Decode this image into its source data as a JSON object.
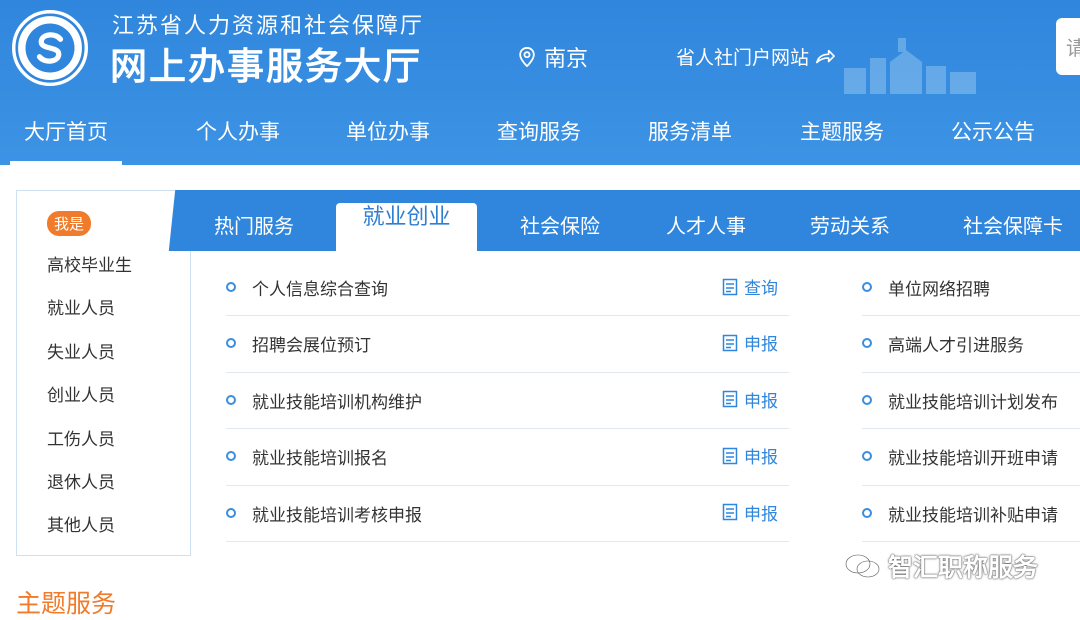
{
  "header": {
    "dept_name": "江苏省人力资源和社会保障厅",
    "hall_name": "网上办事服务大厅",
    "location": "南京",
    "portal_link": "省人社门户网站",
    "search_placeholder": "请"
  },
  "main_nav": [
    {
      "label": "大厅首页",
      "active": true
    },
    {
      "label": "个人办事"
    },
    {
      "label": "单位办事"
    },
    {
      "label": "查询服务"
    },
    {
      "label": "服务清单"
    },
    {
      "label": "主题服务"
    },
    {
      "label": "公示公告"
    }
  ],
  "roles": {
    "badge": "我是",
    "items": [
      "高校毕业生",
      "就业人员",
      "失业人员",
      "创业人员",
      "工伤人员",
      "退休人员",
      "其他人员"
    ]
  },
  "tabs": [
    {
      "label": "热门服务"
    },
    {
      "label": "就业创业",
      "active": true
    },
    {
      "label": "社会保险"
    },
    {
      "label": "人才人事"
    },
    {
      "label": "劳动关系"
    },
    {
      "label": "社会保障卡"
    }
  ],
  "services_left": [
    {
      "name": "个人信息综合查询",
      "action": "查询"
    },
    {
      "name": "招聘会展位预订",
      "action": "申报"
    },
    {
      "name": "就业技能培训机构维护",
      "action": "申报"
    },
    {
      "name": "就业技能培训报名",
      "action": "申报"
    },
    {
      "name": "就业技能培训考核申报",
      "action": "申报"
    }
  ],
  "services_right": [
    {
      "name": "单位网络招聘"
    },
    {
      "name": "高端人才引进服务"
    },
    {
      "name": "就业技能培训计划发布"
    },
    {
      "name": "就业技能培训开班申请"
    },
    {
      "name": "就业技能培训补贴申请"
    }
  ],
  "theme_section_title": "主题服务",
  "watermark": "智汇职称服务",
  "colors": {
    "primary": "#2f86dc",
    "accent_orange": "#f07b2a",
    "text": "#333333"
  }
}
